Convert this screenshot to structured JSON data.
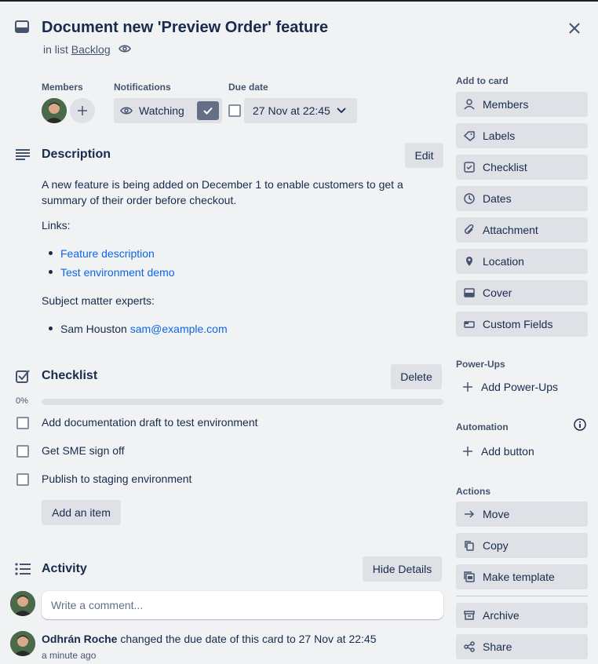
{
  "card": {
    "title": "Document new 'Preview Order' feature",
    "in_list_prefix": "in list",
    "list_name": "Backlog"
  },
  "labels": {
    "members": "Members",
    "notifications": "Notifications",
    "due_date": "Due date"
  },
  "notifications": {
    "watching_label": "Watching"
  },
  "due": {
    "value": "27 Nov at 22:45"
  },
  "description": {
    "title": "Description",
    "edit_label": "Edit",
    "paragraph": "A new feature is being added on December 1 to enable customers to get a summary of their order before checkout.",
    "links_heading": "Links:",
    "links": [
      "Feature description",
      "Test environment demo"
    ],
    "experts_heading": "Subject matter experts:",
    "expert_name": "Sam Houston",
    "expert_email": "sam@example.com"
  },
  "checklist": {
    "title": "Checklist",
    "delete_label": "Delete",
    "progress_text": "0%",
    "progress_fraction": 0,
    "items": [
      "Add documentation draft to test environment",
      "Get SME sign off",
      "Publish to staging environment"
    ],
    "add_item_label": "Add an item"
  },
  "activity": {
    "title": "Activity",
    "hide_details_label": "Hide Details",
    "comment_placeholder": "Write a comment...",
    "entry_user": "Odhrán Roche",
    "entry_text": "changed the due date of this card to 27 Nov at 22:45",
    "entry_time": "a minute ago"
  },
  "sidebar": {
    "add_to_card_label": "Add to card",
    "add_to_card": [
      "Members",
      "Labels",
      "Checklist",
      "Dates",
      "Attachment",
      "Location",
      "Cover",
      "Custom Fields"
    ],
    "powerups_label": "Power-Ups",
    "add_powerups": "Add Power-Ups",
    "automation_label": "Automation",
    "add_button": "Add button",
    "actions_label": "Actions",
    "actions": [
      "Move",
      "Copy",
      "Make template"
    ],
    "archive": "Archive",
    "share": "Share"
  },
  "colors": {
    "accent": "#0c66e4",
    "watch_check_bg": "#626f86",
    "button_bg": "#dfe1e6"
  }
}
